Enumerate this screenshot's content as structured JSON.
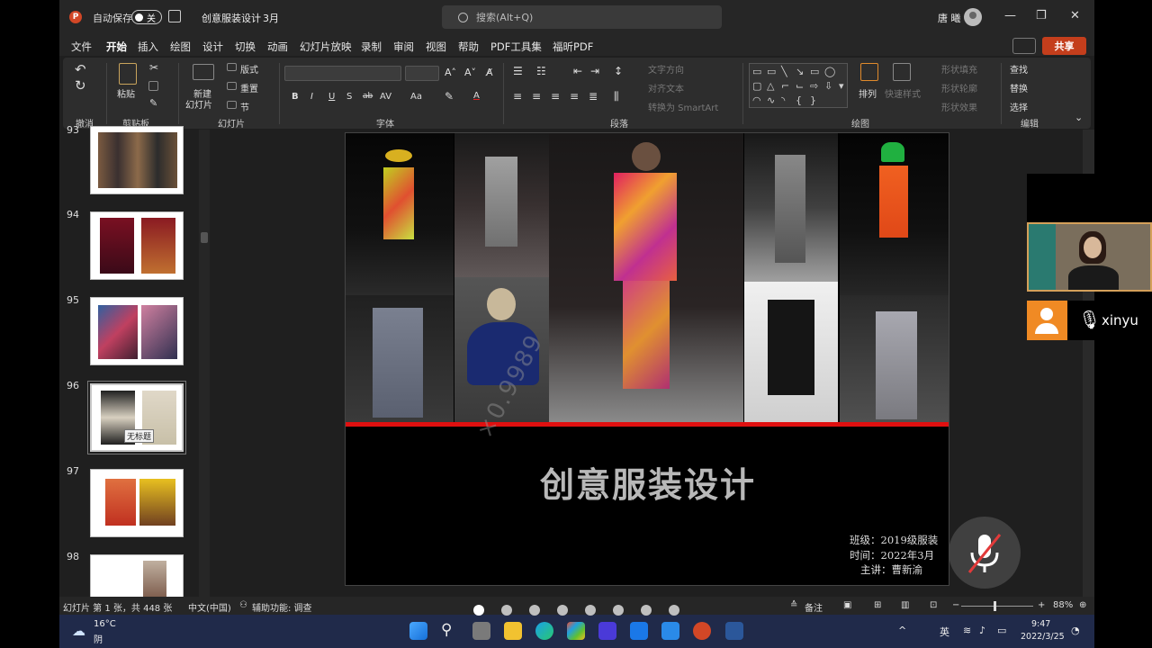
{
  "titlebar": {
    "logo": "P",
    "autosave_label": "自动保存",
    "autosave_state": "关",
    "doc_title": "创意服装设计",
    "doc_month": "3月",
    "search_placeholder": "搜索(Alt+Q)",
    "user_name": "唐 曦",
    "minimize": "—",
    "maximize": "❐",
    "close": "✕"
  },
  "menu": {
    "tabs": [
      "文件",
      "开始",
      "插入",
      "绘图",
      "设计",
      "切换",
      "动画",
      "幻灯片放映",
      "录制",
      "审阅",
      "视图",
      "帮助",
      "PDF工具集",
      "福昕PDF"
    ],
    "share": "共享"
  },
  "ribbon": {
    "groups": [
      "撤消",
      "剪贴板",
      "幻灯片",
      "字体",
      "段落",
      "绘图",
      "编辑"
    ],
    "paste": "粘贴",
    "new_slide_1": "新建",
    "new_slide_2": "幻灯片",
    "layout": "版式",
    "reset": "重置",
    "section": "节",
    "text_direction": "文字方向",
    "align_text": "对齐文本",
    "smartart": "转换为 SmartArt",
    "arrange": "排列",
    "quick_styles": "快速样式",
    "shape_fill": "形状填充",
    "shape_outline": "形状轮廓",
    "shape_effects": "形状效果",
    "find": "查找",
    "replace": "替换",
    "select": "选择",
    "font_buttons": [
      "B",
      "I",
      "U",
      "S",
      "ab",
      "AV",
      "Aa",
      "A"
    ]
  },
  "thumbnails": [
    {
      "num": "93"
    },
    {
      "num": "94"
    },
    {
      "num": "95"
    },
    {
      "num": "96",
      "tooltip": "无标题"
    },
    {
      "num": "97"
    },
    {
      "num": "98"
    }
  ],
  "slide": {
    "title": "创意服装设计",
    "class_line": "班级：2019级服装",
    "time_line": "时间：2022年3月",
    "speaker_line": "主讲：曹新渝",
    "watermark": "×0.9989"
  },
  "statusbar": {
    "slide_count": "幻灯片 第 1 张，共 448 张",
    "language": "中文(中国)",
    "accessibility": "辅助功能: 调查",
    "notes": "备注",
    "zoom": "88%"
  },
  "taskbar": {
    "weather_temp": "16°C",
    "weather_desc": "阴",
    "ime": "英",
    "time": "9:47",
    "date": "2022/3/25"
  },
  "meeting": {
    "participant": "xinyu"
  },
  "colors": {
    "accent": "#d24726",
    "red_bar": "#e01010",
    "share": "#c43e1c",
    "avatar": "#f08a24"
  }
}
